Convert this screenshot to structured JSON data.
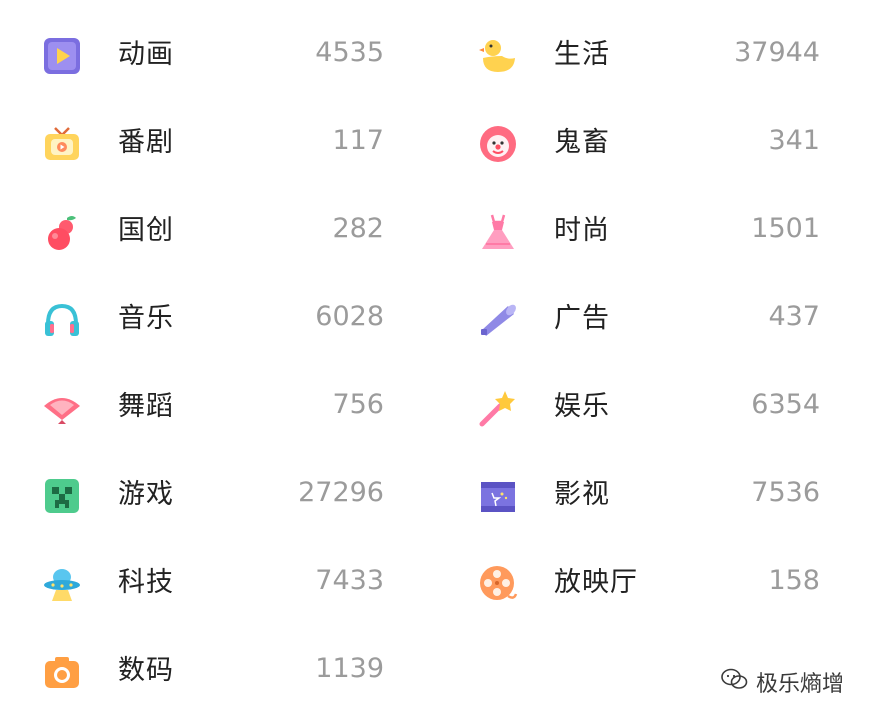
{
  "left": [
    {
      "label": "动画",
      "count": "4535",
      "icon": "anime-play-icon"
    },
    {
      "label": "番剧",
      "count": "117",
      "icon": "tv-icon"
    },
    {
      "label": "国创",
      "count": "282",
      "icon": "gourd-icon"
    },
    {
      "label": "音乐",
      "count": "6028",
      "icon": "headphones-icon"
    },
    {
      "label": "舞蹈",
      "count": "756",
      "icon": "fan-icon"
    },
    {
      "label": "游戏",
      "count": "27296",
      "icon": "creeper-icon"
    },
    {
      "label": "科技",
      "count": "7433",
      "icon": "ufo-icon"
    },
    {
      "label": "数码",
      "count": "1139",
      "icon": "camera-icon"
    }
  ],
  "right": [
    {
      "label": "生活",
      "count": "37944",
      "icon": "duck-icon"
    },
    {
      "label": "鬼畜",
      "count": "341",
      "icon": "clown-icon"
    },
    {
      "label": "时尚",
      "count": "1501",
      "icon": "dress-icon"
    },
    {
      "label": "广告",
      "count": "437",
      "icon": "megaphone-icon"
    },
    {
      "label": "娱乐",
      "count": "6354",
      "icon": "magic-wand-icon"
    },
    {
      "label": "影视",
      "count": "7536",
      "icon": "clapperboard-icon"
    },
    {
      "label": "放映厅",
      "count": "158",
      "icon": "film-reel-icon"
    }
  ],
  "watermark": {
    "text": "极乐熵增",
    "icon": "wechat-icon"
  },
  "colors": {
    "label": "#222222",
    "count": "#9b9b9b"
  }
}
